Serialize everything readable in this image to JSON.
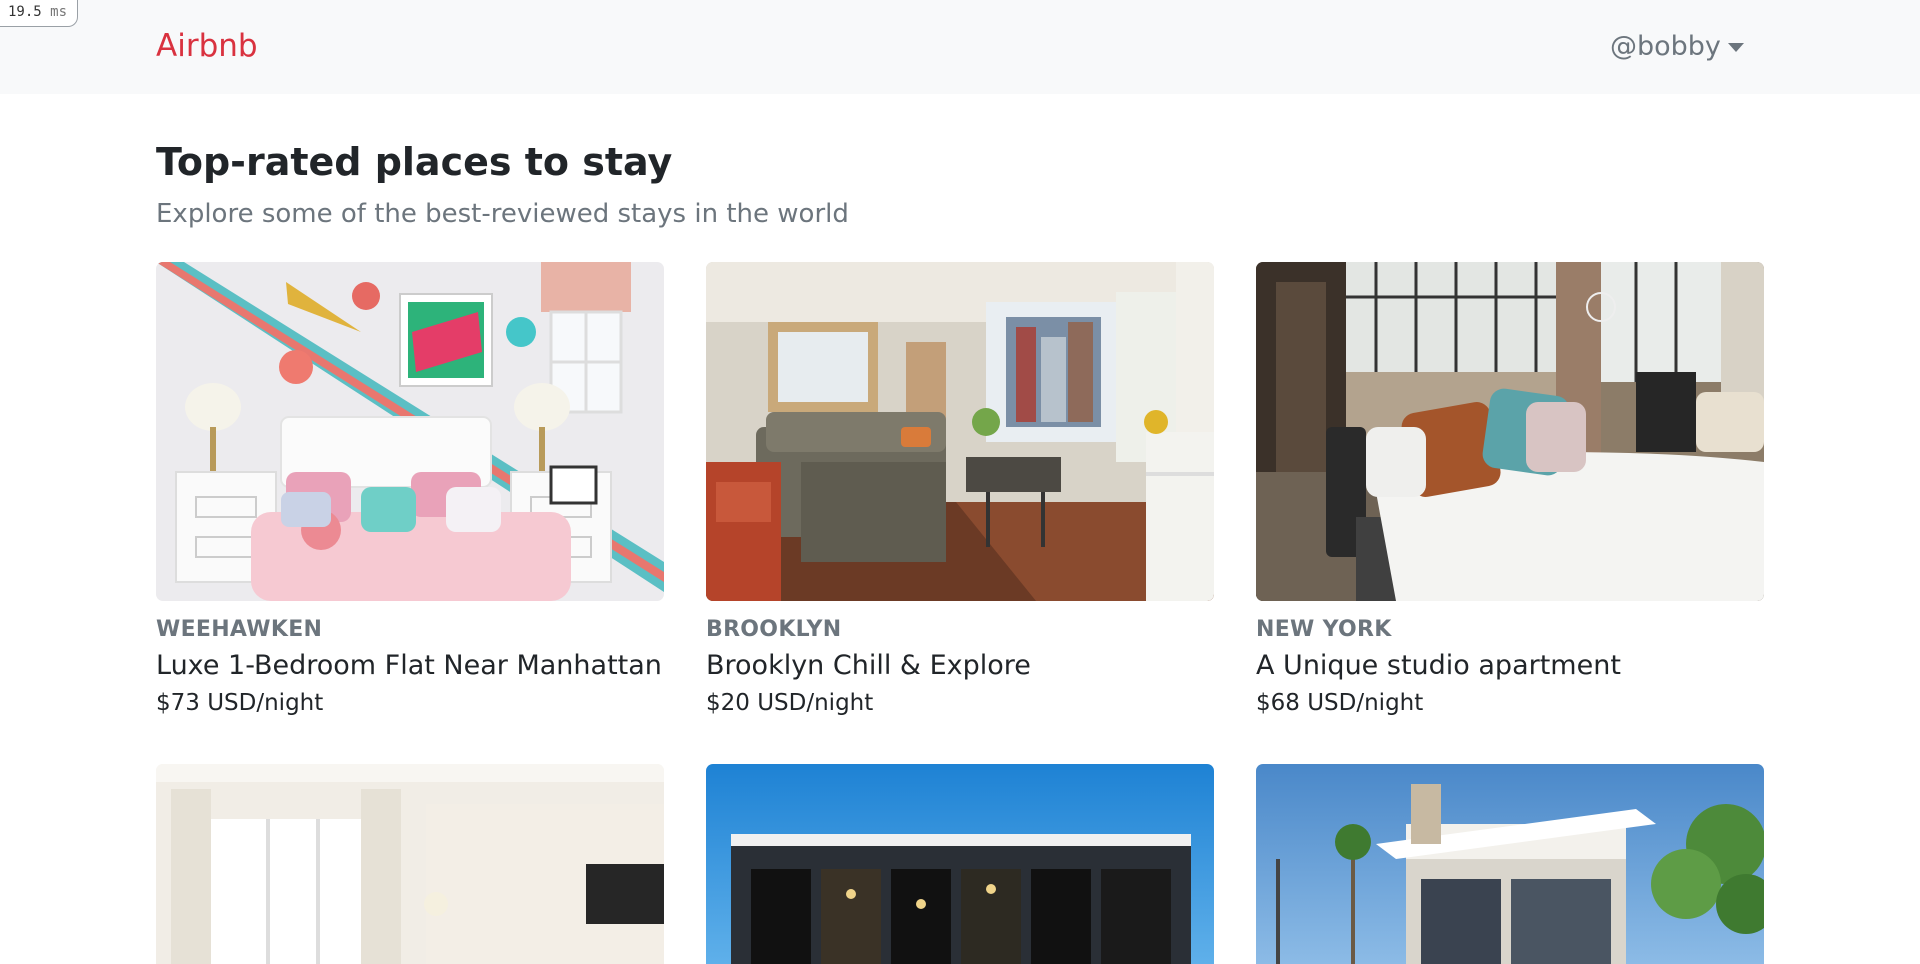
{
  "perf_badge": {
    "value": "19.5",
    "unit": "ms"
  },
  "navbar": {
    "brand": "Airbnb",
    "user": "@bobby"
  },
  "header": {
    "title": "Top-rated places to stay",
    "subtitle": "Explore some of the best-reviewed stays in the world"
  },
  "listings": [
    {
      "city": "WEEHAWKEN",
      "name": "Luxe 1-Bedroom Flat Near Manhattan",
      "price": "$73 USD/night"
    },
    {
      "city": "BROOKLYN",
      "name": "Brooklyn Chill & Explore",
      "price": "$20 USD/night"
    },
    {
      "city": "NEW YORK",
      "name": "A Unique studio apartment",
      "price": "$68 USD/night"
    }
  ],
  "colors": {
    "brand": "#d9323f",
    "navbar_bg": "#f8f9fa",
    "muted": "#6c757d",
    "text": "#212529"
  }
}
